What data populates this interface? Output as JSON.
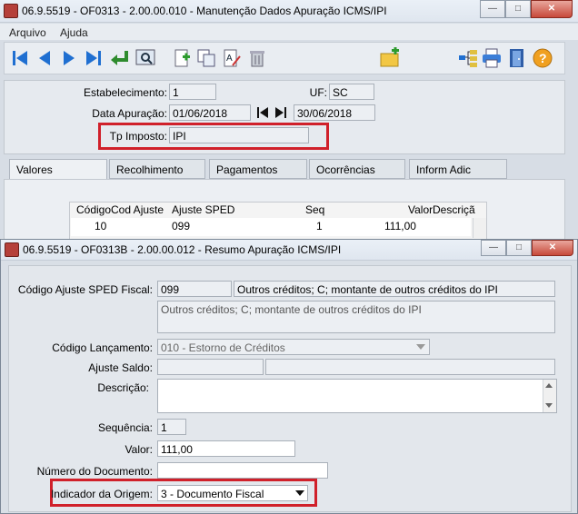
{
  "back_window": {
    "title": "06.9.5519 - OF0313 - 2.00.00.010 - Manutenção Dados Apuração ICMS/IPI",
    "menu": [
      "Arquivo",
      "Ajuda"
    ],
    "fields": {
      "estabelecimento_label": "Estabelecimento:",
      "estabelecimento_value": "1",
      "uf_label": "UF:",
      "uf_value": "SC",
      "data_label": "Data Apuração:",
      "data_from": "01/06/2018",
      "data_to": "30/06/2018",
      "tp_imposto_label": "Tp Imposto:",
      "tp_imposto_value": "IPI"
    },
    "tabs": [
      "Valores",
      "Recolhimento",
      "Pagamentos",
      "Ocorrências",
      "Inform Adic"
    ],
    "grid": {
      "headers": [
        "Código",
        "Cod Ajuste",
        "Ajuste SPED",
        "Seq",
        "Valor",
        "Descriçã"
      ],
      "row": [
        "10",
        "",
        "099",
        "1",
        "111,00",
        ""
      ]
    }
  },
  "front_window": {
    "title": "06.9.5519 - OF0313B - 2.00.00.012 - Resumo Apuração ICMS/IPI",
    "codigo_ajuste_label": "Código Ajuste SPED Fiscal:",
    "codigo_ajuste_value": "099",
    "codigo_ajuste_desc": "Outros créditos; C; montante de outros créditos do IPI",
    "codigo_ajuste_memo": "Outros créditos; C; montante de outros créditos do IPI",
    "codigo_lancamento_label": "Código Lançamento:",
    "codigo_lancamento_value": "010 - Estorno de Créditos",
    "ajuste_saldo_label": "Ajuste Saldo:",
    "descricao_label": "Descrição:",
    "sequencia_label": "Sequência:",
    "sequencia_value": "1",
    "valor_label": "Valor:",
    "valor_value": "111,00",
    "numero_documento_label": "Número do Documento:",
    "indicador_origem_label": "Indicador da Origem:",
    "indicador_origem_value": "3 - Documento Fiscal"
  },
  "colors": {
    "highlight": "#d0202a",
    "toolbar_blue": "#1f6fd1"
  }
}
